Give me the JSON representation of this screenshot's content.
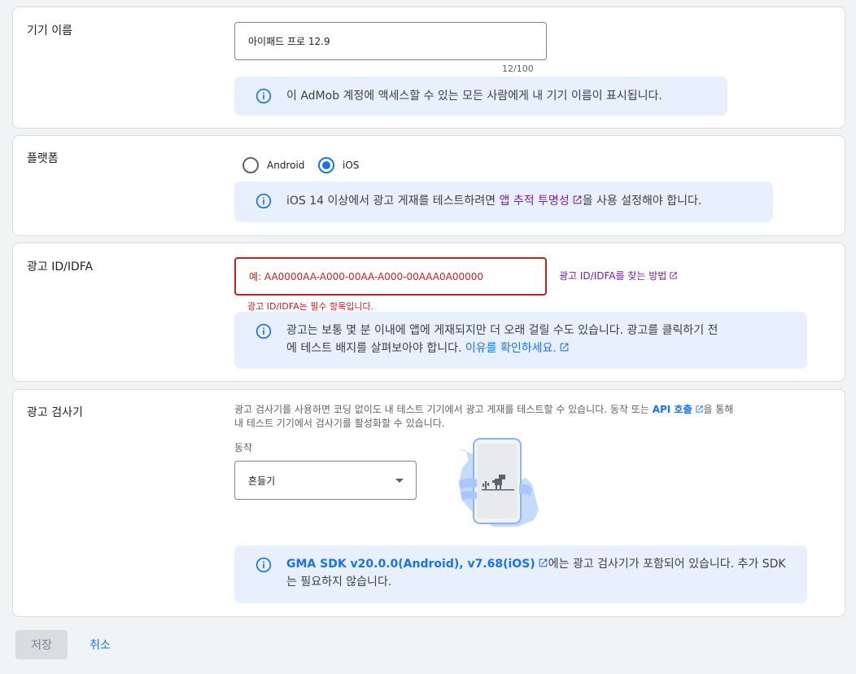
{
  "device_name": {
    "title": "기기 이름",
    "value": "아이패드 프로 12.9",
    "counter": "12/100",
    "info": "이 AdMob 계정에 액세스할 수 있는 모든 사람에게 내 기기 이름이 표시됩니다."
  },
  "platform": {
    "title": "플랫폼",
    "options": [
      "Android",
      "iOS"
    ],
    "selected": "iOS",
    "info_prefix": "iOS 14 이상에서 광고 게재를 테스트하려면 ",
    "info_link": "앱 추적 투명성",
    "info_suffix": "을 사용 설정해야 합니다."
  },
  "ad_id": {
    "title": "광고 ID/IDFA",
    "placeholder": "예: AA0000AA-A000-00AA-A000-00AAA0A00000",
    "help_link": "광고 ID/IDFA를 찾는 방법",
    "error": "광고 ID/IDFA는 필수 항목입니다.",
    "info_line1": "광고는 보통 몇 분 이내에 앱에 게재되지만 더 오래 걸릴 수도 있습니다. 광고를 클릭하기 전",
    "info_line2_prefix": "에 테스트 배지를 살펴보아야 합니다. ",
    "info_link": "이유를 확인하세요."
  },
  "ad_inspector": {
    "title": "광고 검사기",
    "desc_line1_prefix": "광고 검사기를 사용하면 코딩 없이도 내 테스트 기기에서 광고 게재를 테스트할 수 있습니다. 동작 또는 ",
    "desc_link": "API 호출",
    "desc_line1_suffix": "을 통해",
    "desc_line2": "내 테스트 기기에서 검사기를 활성화할 수 있습니다.",
    "gesture_label": "동작",
    "gesture_value": "흔들기",
    "info_link": "GMA SDK v20.0.0(Android), v7.68(iOS)",
    "info_line1_suffix": "에는 광고 검사기가 포함되어 있습니다. 추가 SDK",
    "info_line2": "는 필요하지 않습니다."
  },
  "footer": {
    "save_label": "저장",
    "cancel_label": "취소"
  },
  "colors": {
    "primary": "#1a73e8",
    "error": "#c5221f",
    "link_visited": "#7b1fa2",
    "info_bg": "#e8f0fe"
  }
}
